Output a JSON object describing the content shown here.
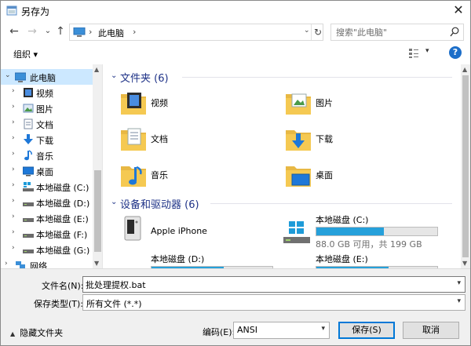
{
  "window": {
    "title": "另存为",
    "close": "✕"
  },
  "nav": {
    "back": "←",
    "forward": "→",
    "recent": "⌄",
    "up": "↑",
    "breadcrumb_sep": "›",
    "path": "此电脑",
    "path_end_sep": "›",
    "dropdown": "⌄",
    "refresh": "↻"
  },
  "search": {
    "placeholder": "搜索\"此电脑\""
  },
  "toolbar": {
    "organize": "组织 ▾",
    "view_dropdown": "▾",
    "help": "?"
  },
  "sidebar": {
    "items": [
      {
        "label": "此电脑",
        "arrow": "⌄",
        "icon": "pc-icon",
        "selected": true
      },
      {
        "label": "视频",
        "arrow": "›",
        "icon": "video-icon"
      },
      {
        "label": "图片",
        "arrow": "›",
        "icon": "pictures-icon"
      },
      {
        "label": "文档",
        "arrow": "›",
        "icon": "documents-icon"
      },
      {
        "label": "下载",
        "arrow": "›",
        "icon": "download-icon"
      },
      {
        "label": "音乐",
        "arrow": "›",
        "icon": "music-icon"
      },
      {
        "label": "桌面",
        "arrow": "›",
        "icon": "desktop-icon"
      },
      {
        "label": "本地磁盘 (C:)",
        "arrow": "›",
        "icon": "drive-c-icon"
      },
      {
        "label": "本地磁盘 (D:)",
        "arrow": "›",
        "icon": "drive-icon"
      },
      {
        "label": "本地磁盘 (E:)",
        "arrow": "›",
        "icon": "drive-icon"
      },
      {
        "label": "本地磁盘 (F:)",
        "arrow": "›",
        "icon": "drive-icon"
      },
      {
        "label": "本地磁盘 (G:)",
        "arrow": "›",
        "icon": "drive-icon"
      },
      {
        "label": "网络",
        "arrow": "›",
        "icon": "network-icon"
      }
    ]
  },
  "content": {
    "folders_header": "文件夹 (6)",
    "folders": [
      {
        "label": "视频",
        "icon": "video-folder-icon"
      },
      {
        "label": "图片",
        "icon": "pictures-folder-icon"
      },
      {
        "label": "文档",
        "icon": "documents-folder-icon"
      },
      {
        "label": "下载",
        "icon": "download-folder-icon"
      },
      {
        "label": "音乐",
        "icon": "music-folder-icon"
      },
      {
        "label": "桌面",
        "icon": "desktop-folder-icon"
      }
    ],
    "devices_header": "设备和驱动器 (6)",
    "devices": [
      {
        "label": "Apple iPhone",
        "icon": "iphone-device-icon"
      },
      {
        "label": "本地磁盘 (C:)",
        "icon": "windows-drive-icon",
        "used_fraction": 0.56,
        "size_text": "88.0 GB 可用，共 199 GB"
      },
      {
        "label": "本地磁盘 (D:)",
        "icon": "drive-icon",
        "used_fraction": 0.6
      },
      {
        "label": "本地磁盘 (E:)",
        "icon": "drive-icon",
        "used_fraction": 0.6
      }
    ]
  },
  "form": {
    "filename_label": "文件名(N):",
    "filename_value": "批处理提权.bat",
    "filetype_label": "保存类型(T):",
    "filetype_value": "所有文件  (*.*)",
    "hide_folders": "隐藏文件夹",
    "encoding_label": "编码(E):",
    "encoding_value": "ANSI",
    "save": "保存(S)",
    "cancel": "取消"
  },
  "colors": {
    "accent": "#0078d7",
    "selection": "#cce8ff",
    "drive_bar": "#26a0da",
    "header_text": "#1e3287",
    "folder_yellow": "#f5c952"
  }
}
